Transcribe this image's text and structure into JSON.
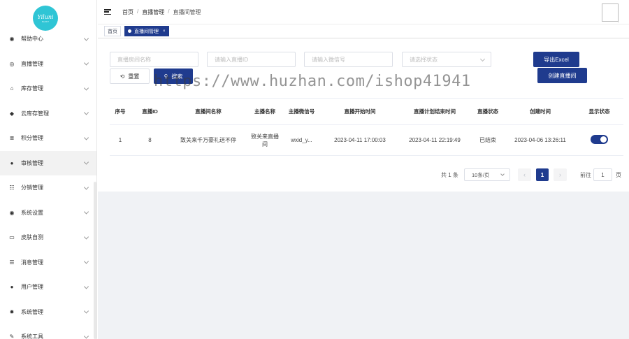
{
  "logo": {
    "text": "Yiluni",
    "subtext": "SHOP"
  },
  "sidebar": {
    "items": [
      {
        "label": "帮助中心",
        "icon": "github-icon",
        "glyph": "◉"
      },
      {
        "label": "直播管理",
        "icon": "eye-icon",
        "glyph": "◎"
      },
      {
        "label": "库存管理",
        "icon": "bank-icon",
        "glyph": "⌂"
      },
      {
        "label": "云库存管理",
        "icon": "tag-icon",
        "glyph": "◆"
      },
      {
        "label": "积分管理",
        "icon": "coins-icon",
        "glyph": "≣"
      },
      {
        "label": "审核管理",
        "icon": "users-icon",
        "glyph": "●"
      },
      {
        "label": "分销管理",
        "icon": "list-icon",
        "glyph": "☷"
      },
      {
        "label": "系统设置",
        "icon": "settings-circle-icon",
        "glyph": "◉"
      },
      {
        "label": "皮肤自测",
        "icon": "monitor-icon",
        "glyph": "▭"
      },
      {
        "label": "消息管理",
        "icon": "list-lines-icon",
        "glyph": "☰"
      },
      {
        "label": "用户管理",
        "icon": "user-group-icon",
        "glyph": "●"
      },
      {
        "label": "系统管理",
        "icon": "gear-icon",
        "glyph": "✹"
      },
      {
        "label": "系统工具",
        "icon": "tools-icon",
        "glyph": "✎"
      }
    ],
    "active_index": 5
  },
  "header": {
    "breadcrumb": [
      "首页",
      "直播管理",
      "直播间管理"
    ],
    "separator": "/"
  },
  "tags": {
    "home": "首页",
    "active": "直播间管理",
    "close": "×"
  },
  "filters": {
    "room_name_placeholder": "直播房间名称",
    "anchor_id_placeholder": "请输入直播ID",
    "wechat_placeholder": "请输入微信号",
    "status_placeholder": "请选择状态"
  },
  "buttons": {
    "reset": "重置",
    "search": "搜索",
    "export": "导出Excel",
    "create": "创建直播间",
    "accent_color": "#1f3b8e"
  },
  "watermark": "https://www.huzhan.com/ishop41941",
  "table": {
    "headers": [
      "序号",
      "直播ID",
      "直播间名称",
      "主播名称",
      "主播微信号",
      "直播开始时间",
      "直播计划结束时间",
      "直播状态",
      "创建时间",
      "显示状态"
    ],
    "rows": [
      {
        "index": "1",
        "live_id": "8",
        "room_name": "致关来千万豪礼送不停",
        "anchor_name": "致关来直播间",
        "wechat": "wxid_y...",
        "start_time": "2023-04-11 17:00:03",
        "end_time": "2023-04-11 22:19:49",
        "status": "已结束",
        "created": "2023-04-06 13:26:11",
        "visible": true
      }
    ]
  },
  "pagination": {
    "total": "共 1 条",
    "page_size": "10条/页",
    "current_page": "1",
    "goto_label": "前往",
    "goto_value": "1",
    "page_suffix": "页",
    "prev": "‹",
    "next": "›"
  }
}
